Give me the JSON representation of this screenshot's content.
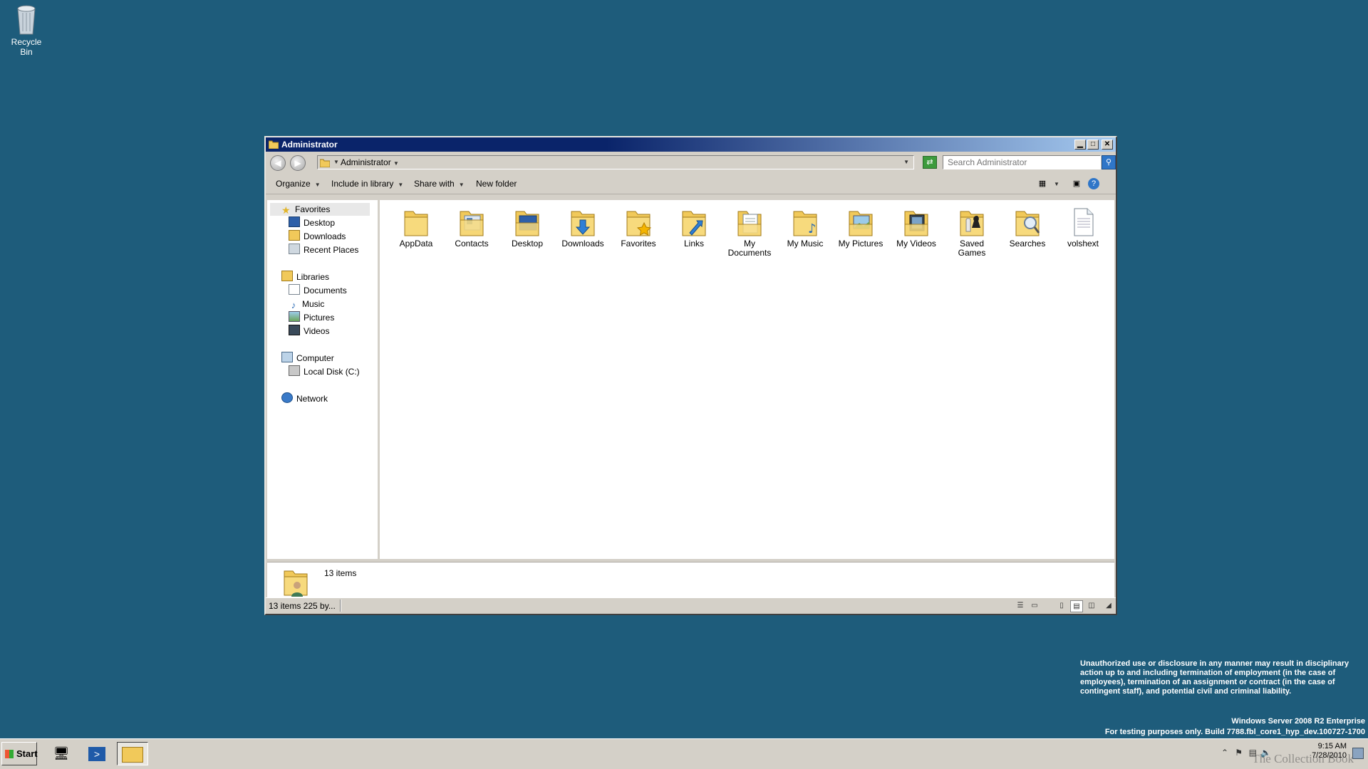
{
  "desktop": {
    "recycle_bin": "Recycle Bin",
    "legal_notice": "Unauthorized use or disclosure in any manner may result in disciplinary action up to and including termination of employment (in the case of employees), termination of an assignment or contract (in the case of contingent staff), and potential civil and criminal liability.",
    "edition": "Windows Server 2008 R2 Enterprise",
    "build": "For testing purposes only. Build 7788.fbl_core1_hyp_dev.100727-1700",
    "watermark": "The Collection Book"
  },
  "window": {
    "title": "Administrator",
    "address_crumb": "Administrator",
    "search_placeholder": "Search Administrator",
    "toolbar": {
      "organize": "Organize",
      "include_in_library": "Include in library",
      "share_with": "Share with",
      "new_folder": "New folder"
    },
    "nav": {
      "favorites": "Favorites",
      "desktop": "Desktop",
      "downloads": "Downloads",
      "recent_places": "Recent Places",
      "libraries": "Libraries",
      "documents": "Documents",
      "music": "Music",
      "pictures": "Pictures",
      "videos": "Videos",
      "computer": "Computer",
      "local_disk": "Local Disk (C:)",
      "network": "Network"
    },
    "items": [
      {
        "name": "AppData",
        "icon": "folder-icon"
      },
      {
        "name": "Contacts",
        "icon": "contacts-folder-icon"
      },
      {
        "name": "Desktop",
        "icon": "desktop-folder-icon"
      },
      {
        "name": "Downloads",
        "icon": "downloads-folder-icon"
      },
      {
        "name": "Favorites",
        "icon": "favorites-folder-icon"
      },
      {
        "name": "Links",
        "icon": "links-folder-icon"
      },
      {
        "name": "My Documents",
        "icon": "documents-folder-icon"
      },
      {
        "name": "My Music",
        "icon": "music-folder-icon"
      },
      {
        "name": "My Pictures",
        "icon": "pictures-folder-icon"
      },
      {
        "name": "My Videos",
        "icon": "videos-folder-icon"
      },
      {
        "name": "Saved Games",
        "icon": "games-folder-icon"
      },
      {
        "name": "Searches",
        "icon": "searches-folder-icon"
      },
      {
        "name": "volshext",
        "icon": "file-icon"
      }
    ],
    "details_count": "13 items",
    "status_text": "13 items  225 by..."
  },
  "taskbar": {
    "start": "Start",
    "time": "9:15 AM",
    "date": "7/28/2010"
  },
  "colors": {
    "desktop": "#1e5c7b",
    "titlebar_start": "#0a246a",
    "titlebar_end": "#a6caf0",
    "chrome": "#d4d0c8",
    "folder": "#f1c95a"
  }
}
